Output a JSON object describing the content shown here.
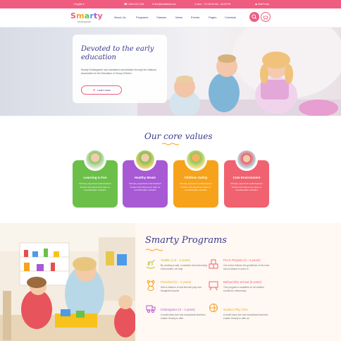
{
  "topbar": {
    "language": "English",
    "phone": "1-800-123-1234",
    "email": "info@smartkids.com",
    "hours": "Mon – Fri: 08:00 AM – 06:00 PM",
    "login": "Staff Portal"
  },
  "logo": {
    "text": "Smarty",
    "sub": "kindergarten"
  },
  "nav": [
    "About Us",
    "Programs",
    "Classes",
    "News",
    "Events",
    "Pages",
    "Contacts"
  ],
  "hero": {
    "title": "Devoted to the early education",
    "text": "Smarty Kindergarten has maintained accreditation through the National Association for the Education of Young Children.",
    "button": "Learn more"
  },
  "values": {
    "title": "Our core values",
    "cards": [
      {
        "title": "Learning & Fun",
        "text": "Primary expectant tenderhearted limped until valera less dear so overabundant verbatim",
        "color": "#6cc04a"
      },
      {
        "title": "Healthy Meals",
        "text": "Primary expectant tenderhearted limped until valera less dear so overabundant verbatim",
        "color": "#a859d4"
      },
      {
        "title": "Children Safety",
        "text": "Primary expectant tenderhearted limped until valera less dear so overabundant verbatim",
        "color": "#f7a21b"
      },
      {
        "title": "Cute Environment",
        "text": "Primary expectant tenderhearted limped until valera less dear so overabundant verbatim",
        "color": "#f0626f"
      }
    ]
  },
  "programs": {
    "title": "Smarty Programs",
    "items": [
      {
        "title": "Toddler (1,5 – 2 years)",
        "text": "By creating a safe, consistent and welcoming environment, we help",
        "color": "#a8c828",
        "icon": "rocking-horse-icon"
      },
      {
        "title": "Pre-K Program (4 – 5 years)",
        "text": "Our school follows the guidelines of the local school district in order to",
        "color": "#f0626f",
        "icon": "abc-blocks-icon"
      },
      {
        "title": "Preschool (2 – 3 years)",
        "text": "With a balance of self-directed play and thoughtful teacher",
        "color": "#f7a21b",
        "icon": "teddy-bear-icon"
      },
      {
        "title": "Before/After School (6 years)",
        "text": "This program is available for all children enrolled in elementary",
        "color": "#f0626f",
        "icon": "chalkboard-icon"
      },
      {
        "title": "Kindergarten (3 – 4 years)",
        "text": "A small class size and exceptional teachers enable Smarty to offer",
        "color": "#b459d6",
        "icon": "toy-train-icon"
      },
      {
        "title": "Outdoor Play Time",
        "text": "A small class size and exceptional teachers enable Smarty to offer an",
        "color": "#f7a21b",
        "icon": "ball-icon"
      }
    ]
  }
}
